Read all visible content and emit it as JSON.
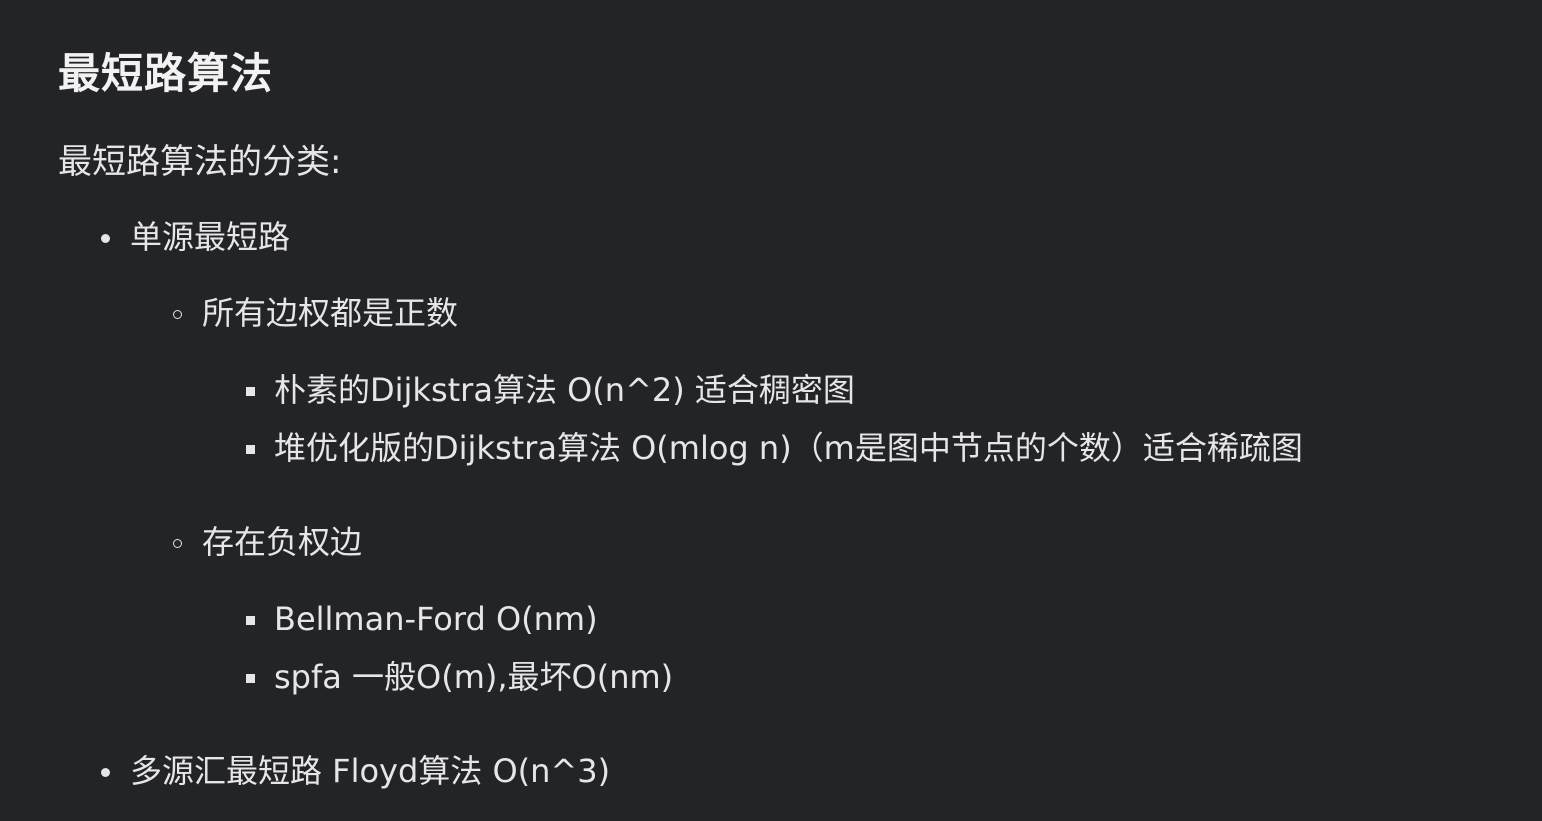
{
  "heading": "最短路算法",
  "intro": "最短路算法的分类:",
  "single_source": {
    "label": "单源最短路",
    "positive": {
      "label": "所有边权都是正数",
      "items": [
        "朴素的Dijkstra算法 O(n^2) 适合稠密图",
        "堆优化版的Dijkstra算法 O(mlog n)（m是图中节点的个数）适合稀疏图"
      ]
    },
    "negative": {
      "label": "存在负权边",
      "items": [
        "Bellman-Ford O(nm)",
        "spfa 一般O(m),最坏O(nm)"
      ]
    }
  },
  "multi_source": {
    "label": "多源汇最短路 Floyd算法 O(n^3)"
  }
}
